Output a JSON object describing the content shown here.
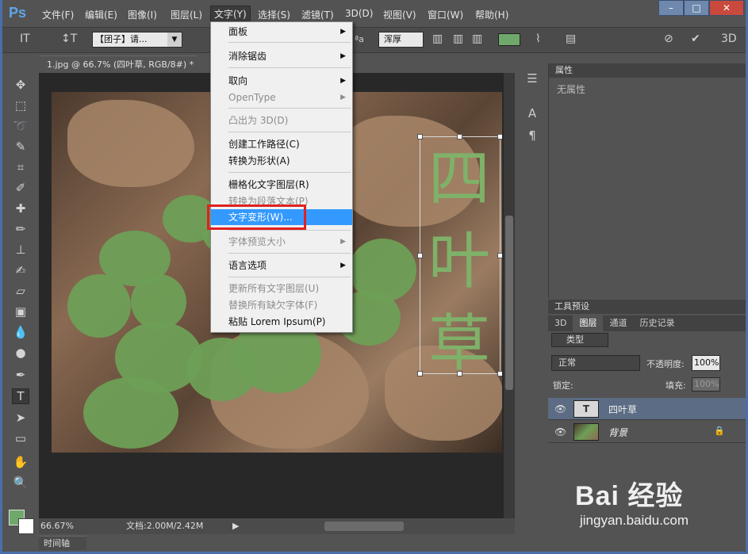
{
  "menubar": {
    "logo": "Ps",
    "items": [
      "文件(F)",
      "编辑(E)",
      "图像(I)",
      "图层(L)",
      "文字(Y)",
      "选择(S)",
      "滤镜(T)",
      "3D(D)",
      "视图(V)",
      "窗口(W)",
      "帮助(H)"
    ],
    "active_index": 4
  },
  "window_buttons": {
    "minimize": "–",
    "maximize": "□",
    "close": "✕"
  },
  "options": {
    "font_family": "【团子】请...",
    "antialias": "浑厚",
    "text_color": "#6fa86b",
    "aa_label": "ªa"
  },
  "document": {
    "tab_title": "1.jpg @ 66.7% (四叶草, RGB/8#) *",
    "text_layer_content": "四叶草",
    "zoom": "66.67%",
    "doc_size": "文档:2.00M/2.42M",
    "timeline_tab": "时间轴"
  },
  "dropdown": {
    "items": [
      {
        "label": "面板",
        "submenu": true,
        "disabled": false
      },
      {
        "label": "消除锯齿",
        "submenu": true,
        "disabled": false
      },
      {
        "label": "取向",
        "submenu": true,
        "disabled": false
      },
      {
        "label": "OpenType",
        "submenu": true,
        "disabled": true
      },
      {
        "label": "凸出为 3D(D)",
        "submenu": false,
        "disabled": true
      },
      {
        "label": "创建工作路径(C)",
        "submenu": false,
        "disabled": false
      },
      {
        "label": "转换为形状(A)",
        "submenu": false,
        "disabled": false
      },
      {
        "label": "栅格化文字图层(R)",
        "submenu": false,
        "disabled": false
      },
      {
        "label": "转换为段落文本(P)",
        "submenu": false,
        "disabled": true
      },
      {
        "label": "文字变形(W)...",
        "submenu": false,
        "disabled": false,
        "highlighted": true
      },
      {
        "label": "字体预览大小",
        "submenu": true,
        "disabled": true
      },
      {
        "label": "语言选项",
        "submenu": true,
        "disabled": false
      },
      {
        "label": "更新所有文字图层(U)",
        "submenu": false,
        "disabled": true
      },
      {
        "label": "替换所有缺欠字体(F)",
        "submenu": false,
        "disabled": true
      },
      {
        "label": "粘贴 Lorem Ipsum(P)",
        "submenu": false,
        "disabled": false
      }
    ]
  },
  "properties_panel": {
    "title": "属性",
    "empty_text": "无属性"
  },
  "tool_presets": {
    "title": "工具预设"
  },
  "layers_panel": {
    "tabs": [
      "3D",
      "图层",
      "通道",
      "历史记录"
    ],
    "active_tab": 1,
    "filter": "类型",
    "blend_mode": "正常",
    "opacity_label": "不透明度:",
    "opacity": "100%",
    "lock_label": "锁定:",
    "fill_label": "填充:",
    "fill": "100%",
    "layers": [
      {
        "name": "四叶草",
        "type": "text",
        "selected": true
      },
      {
        "name": "背景",
        "type": "image",
        "selected": false,
        "locked": true
      }
    ]
  },
  "watermark": {
    "main": "Bai 经验",
    "sub": "jingyan.baidu.com"
  }
}
